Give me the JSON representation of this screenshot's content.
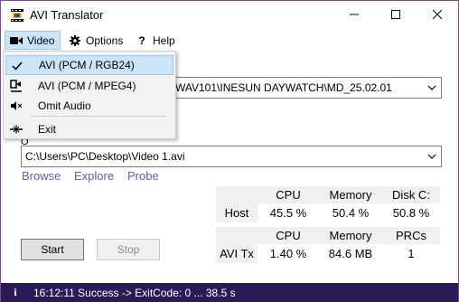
{
  "window": {
    "title": "AVI Translator",
    "buttons": {
      "minimize_icon": "minimize-icon",
      "maximize_icon": "maximize-icon",
      "close_icon": "close-icon"
    }
  },
  "menu": {
    "video": "Video",
    "options": "Options",
    "help": "Help"
  },
  "video_menu": {
    "items": [
      {
        "label": "AVI (PCM / RGB24)",
        "checked": true,
        "icon": "checkmark-icon"
      },
      {
        "label": "AVI (PCM / MPEG4)",
        "checked": false,
        "icon": "mpeg4-icon"
      },
      {
        "label": "Omit Audio",
        "checked": false,
        "icon": "mute-icon"
      },
      {
        "label": "Exit",
        "checked": false,
        "icon": "exit-icon"
      }
    ]
  },
  "source": {
    "path_visible": "WAV101\\INESUN DAYWATCH\\MD_25.02.01"
  },
  "output": {
    "label": "O",
    "path": "C:\\Users\\PC\\Desktop\\Video 1.avi"
  },
  "links": {
    "browse": "Browse",
    "explore": "Explore",
    "probe": "Probe"
  },
  "host_stats": {
    "row_label": "Host",
    "headers": [
      "CPU",
      "Memory",
      "Disk C:"
    ],
    "values": [
      "45.5 %",
      "50.4 %",
      "50.8 %"
    ]
  },
  "avi_stats": {
    "row_label": "AVI Tx",
    "headers": [
      "CPU",
      "Memory",
      "PRCs"
    ],
    "values": [
      "1.40 %",
      "84.6 MB",
      "1"
    ]
  },
  "buttons": {
    "start": "Start",
    "stop": "Stop"
  },
  "status": {
    "icon": "info-icon",
    "text": "16:12:11 Success -> ExitCode: 0 ... 38.5 s"
  },
  "colors": {
    "status_bg": "#2a1b57",
    "link": "#5a62a8",
    "menu_highlight": "#cce4f7"
  }
}
